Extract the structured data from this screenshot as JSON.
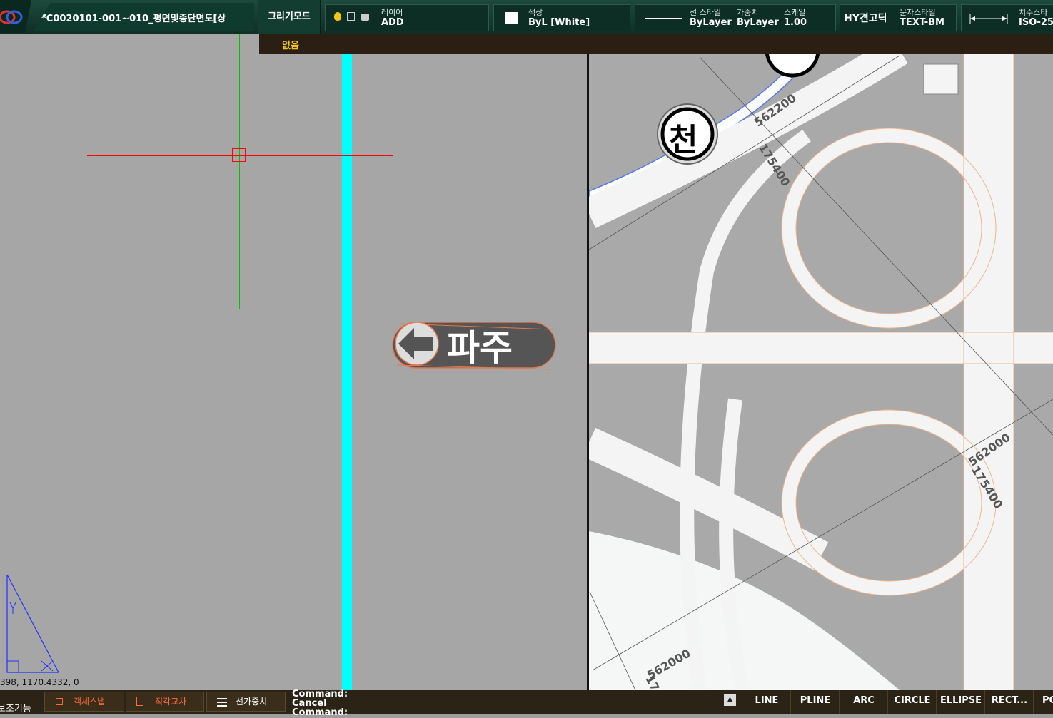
{
  "toolbar": {
    "doc_title": "*C0020101-001~010_평면및종단면도[상",
    "mode_label": "그리기모드",
    "layer_label": "레이어",
    "layer_value": "ADD",
    "color_label": "색상",
    "color_value": "ByL [White]",
    "linestyle_label": "선 스타일",
    "linestyle_value": "ByLayer",
    "weight_label": "가중치",
    "weight_value": "ByLayer",
    "scale_label": "스케일",
    "scale_value": "1.00",
    "font_value": "HY견고딕",
    "textstyle_label": "문자스타일",
    "textstyle_value": "TEXT-BM",
    "dimstyle_label": "치수스타",
    "dimstyle_value": "ISO-25"
  },
  "dropdown": {
    "item": "없음"
  },
  "canvas": {
    "coords": "398, 1170.4332, 0",
    "sign_text": "파주",
    "circle_text": "천",
    "label_a": "562200",
    "label_b": "175400",
    "label_c": "562000",
    "label_d": "175400",
    "label_e": "562000",
    "label_f": "17"
  },
  "bottom": {
    "left_label": "보조기능",
    "snap1": "객체스냅",
    "snap2": "직각교차",
    "snap3": "선가중치",
    "cmd_lines": [
      "Command:",
      "Cancel",
      "Command:"
    ],
    "tools": [
      "LINE",
      "PLINE",
      "ARC",
      "CIRCLE",
      "ELLIPSE",
      "RECT...",
      "PC"
    ]
  },
  "colors": {
    "accent": "#00ffff",
    "crosshair_h": "#ff0000",
    "crosshair_v": "#00c000",
    "ucs": "#2233ff"
  }
}
